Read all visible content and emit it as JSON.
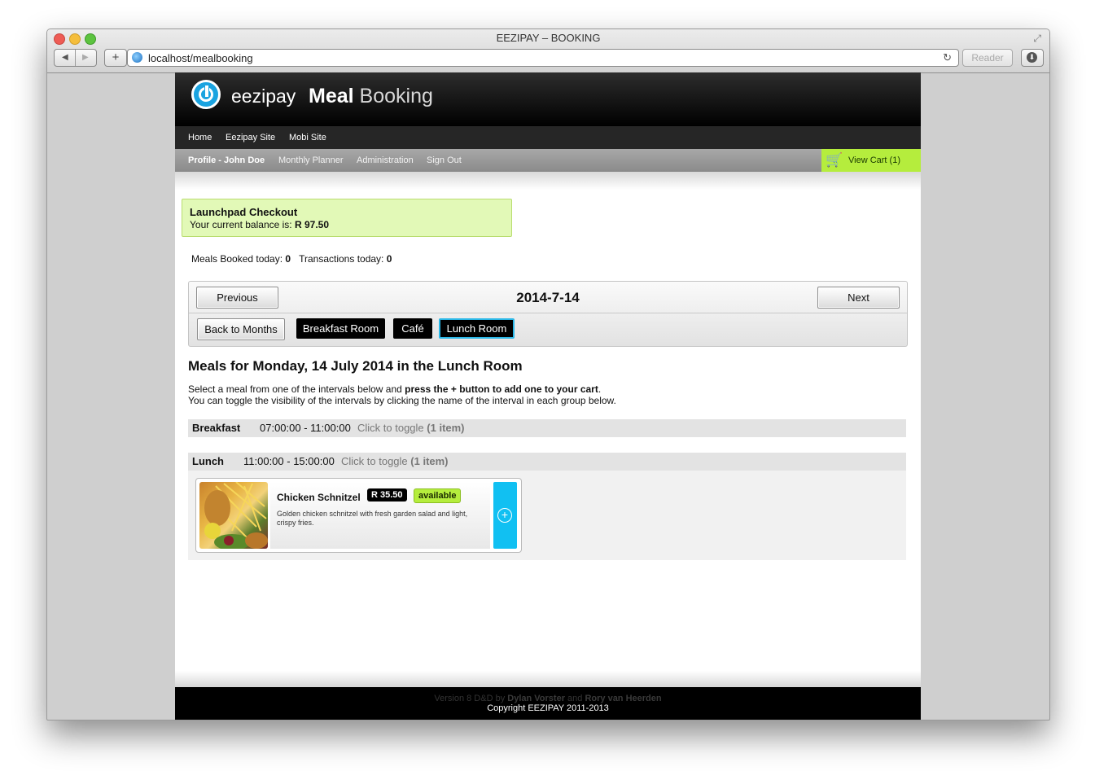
{
  "browser": {
    "title": "EEZIPAY – BOOKING",
    "url": "localhost/mealbooking",
    "reader_label": "Reader",
    "back_glyph": "◀",
    "forward_glyph": "▶",
    "add_glyph": "+",
    "reload_glyph": "↻",
    "fullscreen_glyph": "⤢",
    "download_glyph": "⬇"
  },
  "header": {
    "brand": "eezipay",
    "title_bold": "Meal",
    "title_light": "Booking"
  },
  "menu_primary": [
    "Home",
    "Eezipay Site",
    "Mobi Site"
  ],
  "menu_secondary": {
    "profile": "Profile - John Doe",
    "planner": "Monthly Planner",
    "admin": "Administration",
    "signout": "Sign Out"
  },
  "cart": {
    "icon": "cart-icon",
    "glyph": "🛒",
    "label": "View Cart (1)",
    "color": "#b5ed3d"
  },
  "balance": {
    "title": "Launchpad Checkout",
    "prefix": "Your current balance is: ",
    "amount": "R 97.50"
  },
  "stats": {
    "meals_label": "Meals Booked today: ",
    "meals_value": "0",
    "tx_label": "Transactions today: ",
    "tx_value": "0"
  },
  "day": {
    "previous": "Previous",
    "date": "2014-7-14",
    "next": "Next",
    "back_to_months": "Back to Months",
    "rooms": [
      "Breakfast Room",
      "Café",
      "Lunch Room"
    ],
    "active_room": "Lunch Room"
  },
  "meals": {
    "heading": "Meals for Monday, 14 July 2014 in the Lunch Room",
    "instr_1a": "Select a meal from one of the intervals below and ",
    "instr_1b": "press the + button to add one to your cart",
    "instr_1c": ".",
    "instr_2": "You can toggle the visibility of the intervals by clicking the name of the interval in each group below.",
    "intervals": [
      {
        "name": "Breakfast",
        "time": "07:00:00 - 11:00:00",
        "toggle": "Click to toggle",
        "count": "(1 item)"
      },
      {
        "name": "Lunch",
        "time": "11:00:00 - 15:00:00",
        "toggle": "Click to toggle",
        "count": "(1 item)"
      }
    ],
    "item": {
      "name": "Chicken Schnitzel",
      "price": "R 35.50",
      "status": "available",
      "description": "Golden chicken schnitzel with fresh garden salad and light, crispy fries.",
      "add_glyph": "+"
    }
  },
  "footer": {
    "version_1": "Version 8 D&D by ",
    "author_1": "Dylan Vorster",
    "and": " and ",
    "author_2": "Rory van Heerden",
    "copyright": "Copyright EEZIPAY 2011-2013"
  }
}
